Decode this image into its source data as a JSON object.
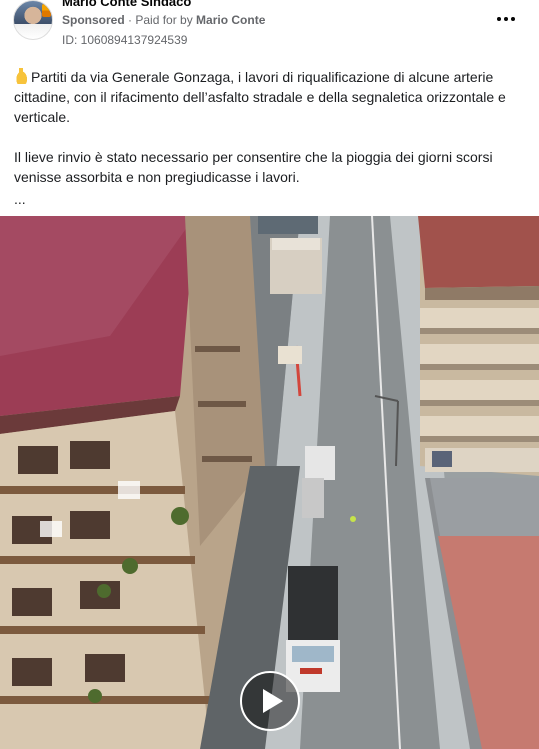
{
  "post": {
    "page_name": "Mario Conte Sindaco",
    "sponsored_label": "Sponsored",
    "separator": " · ",
    "paid_for_prefix": "Paid for by ",
    "payer_name": "Mario Conte",
    "ad_id": "ID: 1060894137924539",
    "paragraph_1": "Partiti da via Generale Gonzaga, i lavori di riqualificazione di alcune arterie cittadine, con il rifacimento dell’asfalto stradale e della segnaletica orizzontale e verticale.",
    "paragraph_2": "Il lieve rinvio è stato necessario per consentire che la pioggia dei giorni scorsi venisse assorbita e non pregiudicasse i lavori.",
    "see_more": "..."
  },
  "icons": {
    "more": "more-horizontal-icon",
    "play": "play-icon",
    "emoji": "pointing-up-hand-emoji"
  },
  "colors": {
    "secondary_text": "#65676b",
    "primary_text": "#1c1e21",
    "play_overlay": "#000000"
  }
}
